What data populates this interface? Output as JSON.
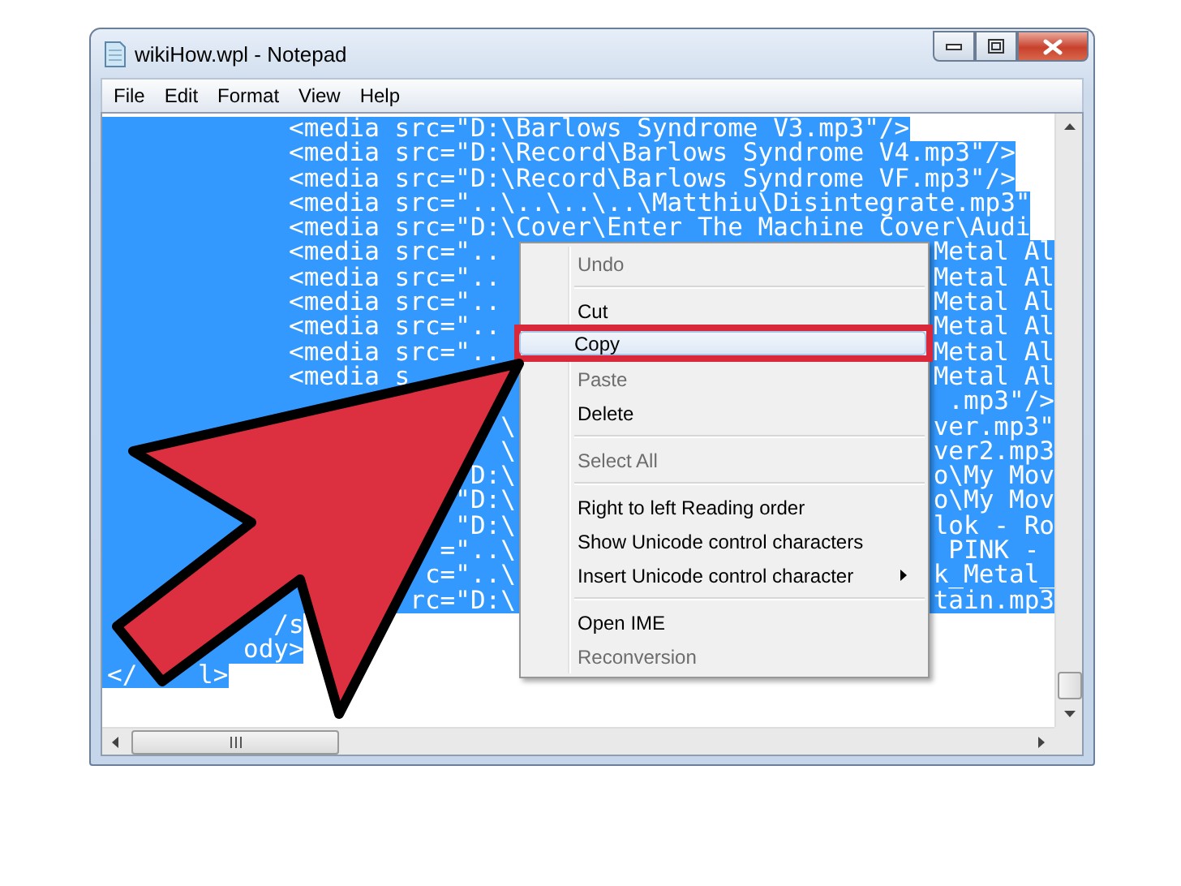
{
  "window": {
    "title": "wikiHow.wpl - Notepad"
  },
  "menu_bar": [
    "File",
    "Edit",
    "Format",
    "View",
    "Help"
  ],
  "editor": {
    "lines": [
      {
        "segments": [
          "            <media src=\"D:\\Barlows Syndrome V3.mp3\"/>"
        ],
        "selected": true
      },
      {
        "segments": [
          "            <media src=\"D:\\Record\\Barlows Syndrome V4.mp3\"/>"
        ],
        "selected": true
      },
      {
        "segments": [
          "            <media src=\"D:\\Record\\Barlows Syndrome VF.mp3\"/>"
        ],
        "selected": true
      },
      {
        "segments": [
          "            <media src=\"..\\..\\..\\..\\Matthiu\\Disintegrate.mp3\""
        ],
        "selected": true
      },
      {
        "segments": [
          "            <media src=\"D:\\Cover\\Enter The Machine Cover\\Audi"
        ],
        "selected": true
      },
      {
        "segments": [
          "            <media src=\".."
        ],
        "right": "Metal Al",
        "selected": true
      },
      {
        "segments": [
          "            <media src=\".."
        ],
        "right": "Metal Al",
        "selected": true
      },
      {
        "segments": [
          "            <media src=\".."
        ],
        "right": "Metal Al",
        "selected": true
      },
      {
        "segments": [
          "            <media src=\".."
        ],
        "right": "Metal Al",
        "selected": true
      },
      {
        "segments": [
          "            <media src=\".."
        ],
        "right": "Metal Al",
        "selected": true
      },
      {
        "segments": [
          "            <media s"
        ],
        "right": "Metal Al",
        "selected": true
      },
      {
        "right": ".mp3\"/>",
        "selected": true
      },
      {
        "segments": [
          "                          \\"
        ],
        "right": "ver.mp3\"",
        "selected": true
      },
      {
        "segments": [
          "                          \\"
        ],
        "right": "ver2.mp3",
        "selected": true
      },
      {
        "segments": [
          "                        D:\\"
        ],
        "right": "o\\My Mov",
        "selected": true
      },
      {
        "segments": [
          "                       \"D:\\"
        ],
        "right": "o\\My Mov",
        "selected": true
      },
      {
        "segments": [
          "                       \"D:\\"
        ],
        "right": "lok - Ro",
        "selected": true
      },
      {
        "segments": [
          "                      =\"..\\"
        ],
        "right": "PINK - ",
        "selected": true
      },
      {
        "segments": [
          "                     c=\"..\\"
        ],
        "right": "k_Metal_",
        "selected": true
      },
      {
        "segments": [
          "                    rc=\"D:\\"
        ],
        "right": "tain.mp3",
        "selected": true
      },
      {
        "segments": [
          "           /s"
        ],
        "selected": true
      },
      {
        "segments": [
          "         ody>"
        ],
        "selected": true
      },
      {
        "segments": [
          "</",
          "    l>"
        ],
        "selected": true
      }
    ]
  },
  "context_menu": {
    "items": [
      {
        "kind": "item",
        "label": "Undo",
        "disabled": true,
        "selected": false,
        "has_submenu": false
      },
      {
        "kind": "separator"
      },
      {
        "kind": "item",
        "label": "Cut",
        "disabled": false,
        "selected": false,
        "has_submenu": false
      },
      {
        "kind": "item",
        "label": "Copy",
        "disabled": false,
        "selected": true,
        "has_submenu": false
      },
      {
        "kind": "item",
        "label": "Paste",
        "disabled": true,
        "selected": false,
        "has_submenu": false
      },
      {
        "kind": "item",
        "label": "Delete",
        "disabled": false,
        "selected": false,
        "has_submenu": false
      },
      {
        "kind": "separator"
      },
      {
        "kind": "item",
        "label": "Select All",
        "disabled": true,
        "selected": false,
        "has_submenu": false
      },
      {
        "kind": "separator"
      },
      {
        "kind": "item",
        "label": "Right to left Reading order",
        "disabled": false,
        "selected": false,
        "has_submenu": false
      },
      {
        "kind": "item",
        "label": "Show Unicode control characters",
        "disabled": false,
        "selected": false,
        "has_submenu": false
      },
      {
        "kind": "item",
        "label": "Insert Unicode control character",
        "disabled": false,
        "selected": false,
        "has_submenu": true
      },
      {
        "kind": "separator"
      },
      {
        "kind": "item",
        "label": "Open IME",
        "disabled": false,
        "selected": false,
        "has_submenu": false
      },
      {
        "kind": "item",
        "label": "Reconversion",
        "disabled": true,
        "selected": false,
        "has_submenu": false
      }
    ]
  }
}
